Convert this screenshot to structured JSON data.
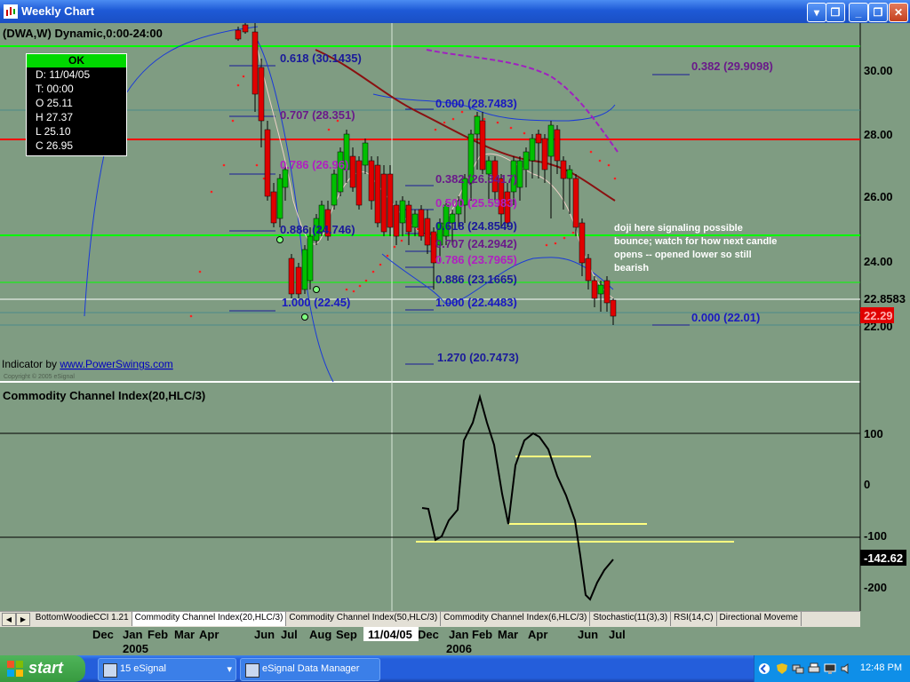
{
  "window": {
    "title": "Weekly Chart",
    "minimize_label": "_",
    "restore_label": "❐",
    "close_label": "✕"
  },
  "chart": {
    "header": "(DWA,W) Dynamic,0:00-24:00",
    "indicator_credit_prefix": "Indicator by ",
    "indicator_credit_link": "www.PowerSwings.com",
    "copyright": "Copyright © 2005 eSignal",
    "cursor_date": "11/04/05",
    "price_ticks": [
      "30.00",
      "28.00",
      "26.00",
      "24.00",
      "22.00"
    ],
    "last_level_label": "22.8583",
    "last_price_label": "22.29",
    "x_labels": [
      "Dec",
      "Jan",
      "Feb",
      "Mar",
      "Apr",
      "Jun",
      "Jul",
      "Aug",
      "Sep",
      "Dec",
      "Jan",
      "Feb",
      "Mar",
      "Apr",
      "Jun",
      "Jul"
    ],
    "year_labels": [
      "2005",
      "2006"
    ],
    "fib_labels": [
      {
        "text": "0.618 (30.1435)",
        "color": "#1a1a9a"
      },
      {
        "text": "0.707 (28.351)",
        "color": "#6a1a8a"
      },
      {
        "text": "0.786 (26.96)",
        "color": "#b020c0"
      },
      {
        "text": "0.886 (24.746)",
        "color": "#1a1a9a"
      },
      {
        "text": "1.000 (22.45)",
        "color": "#1a1ac0"
      },
      {
        "text": "0.000 (28.7483)",
        "color": "#1a1ac0"
      },
      {
        "text": "0.382 (26.3417)",
        "color": "#6a1a8a"
      },
      {
        "text": "0.500 (25.5983)",
        "color": "#b020c0"
      },
      {
        "text": "0.618 (24.8549)",
        "color": "#1a1a9a"
      },
      {
        "text": "0.707 (24.2942)",
        "color": "#6a1a8a"
      },
      {
        "text": "0.786 (23.7965)",
        "color": "#b020c0"
      },
      {
        "text": "0.886 (23.1665)",
        "color": "#1a1a9a"
      },
      {
        "text": "1.000 (22.4483)",
        "color": "#1a1ac0"
      },
      {
        "text": "1.270 (20.7473)",
        "color": "#1a1a9a"
      },
      {
        "text": "0.382 (29.9098)",
        "color": "#6a1a8a"
      },
      {
        "text": "0.000 (22.01)",
        "color": "#1a1ac0"
      }
    ],
    "annotation": [
      "doji here signaling possible",
      "bounce; watch for how next candle",
      "opens -- opened lower so still",
      "bearish"
    ]
  },
  "ohlc_box": {
    "status": "OK",
    "rows": [
      "D: 11/04/05",
      "T: 00:00",
      "O 25.11",
      "H 27.37",
      "L 25.10",
      "C 26.95"
    ]
  },
  "cci": {
    "title": "Commodity Channel Index(20,HLC/3)",
    "ticks": [
      "100",
      "0",
      "-100",
      "-200"
    ],
    "value_label": "-142.62"
  },
  "tabs": [
    "BottomWoodieCCI 1.21",
    "Commodity Channel Index(20,HLC/3)",
    "Commodity Channel Index(50,HLC/3)",
    "Commodity Channel Index(6,HLC/3)",
    "Stochastic(11(3),3)",
    "RSI(14,C)",
    "Directional Moveme"
  ],
  "tab_nav": [
    "◀",
    "▶"
  ],
  "taskbar": {
    "start": "start",
    "buttons": [
      {
        "label": "15 eSignal"
      },
      {
        "label": "eSignal Data Manager"
      }
    ],
    "clock": "12:48 PM"
  },
  "colors": {
    "background": "#7f9c82",
    "bull_candle": "#00c000",
    "bear_candle": "#e00000",
    "cci_line": "#000000",
    "support_line": "#ffff80",
    "resistance_line": "#ff0000",
    "green_line": "#00ff00"
  }
}
